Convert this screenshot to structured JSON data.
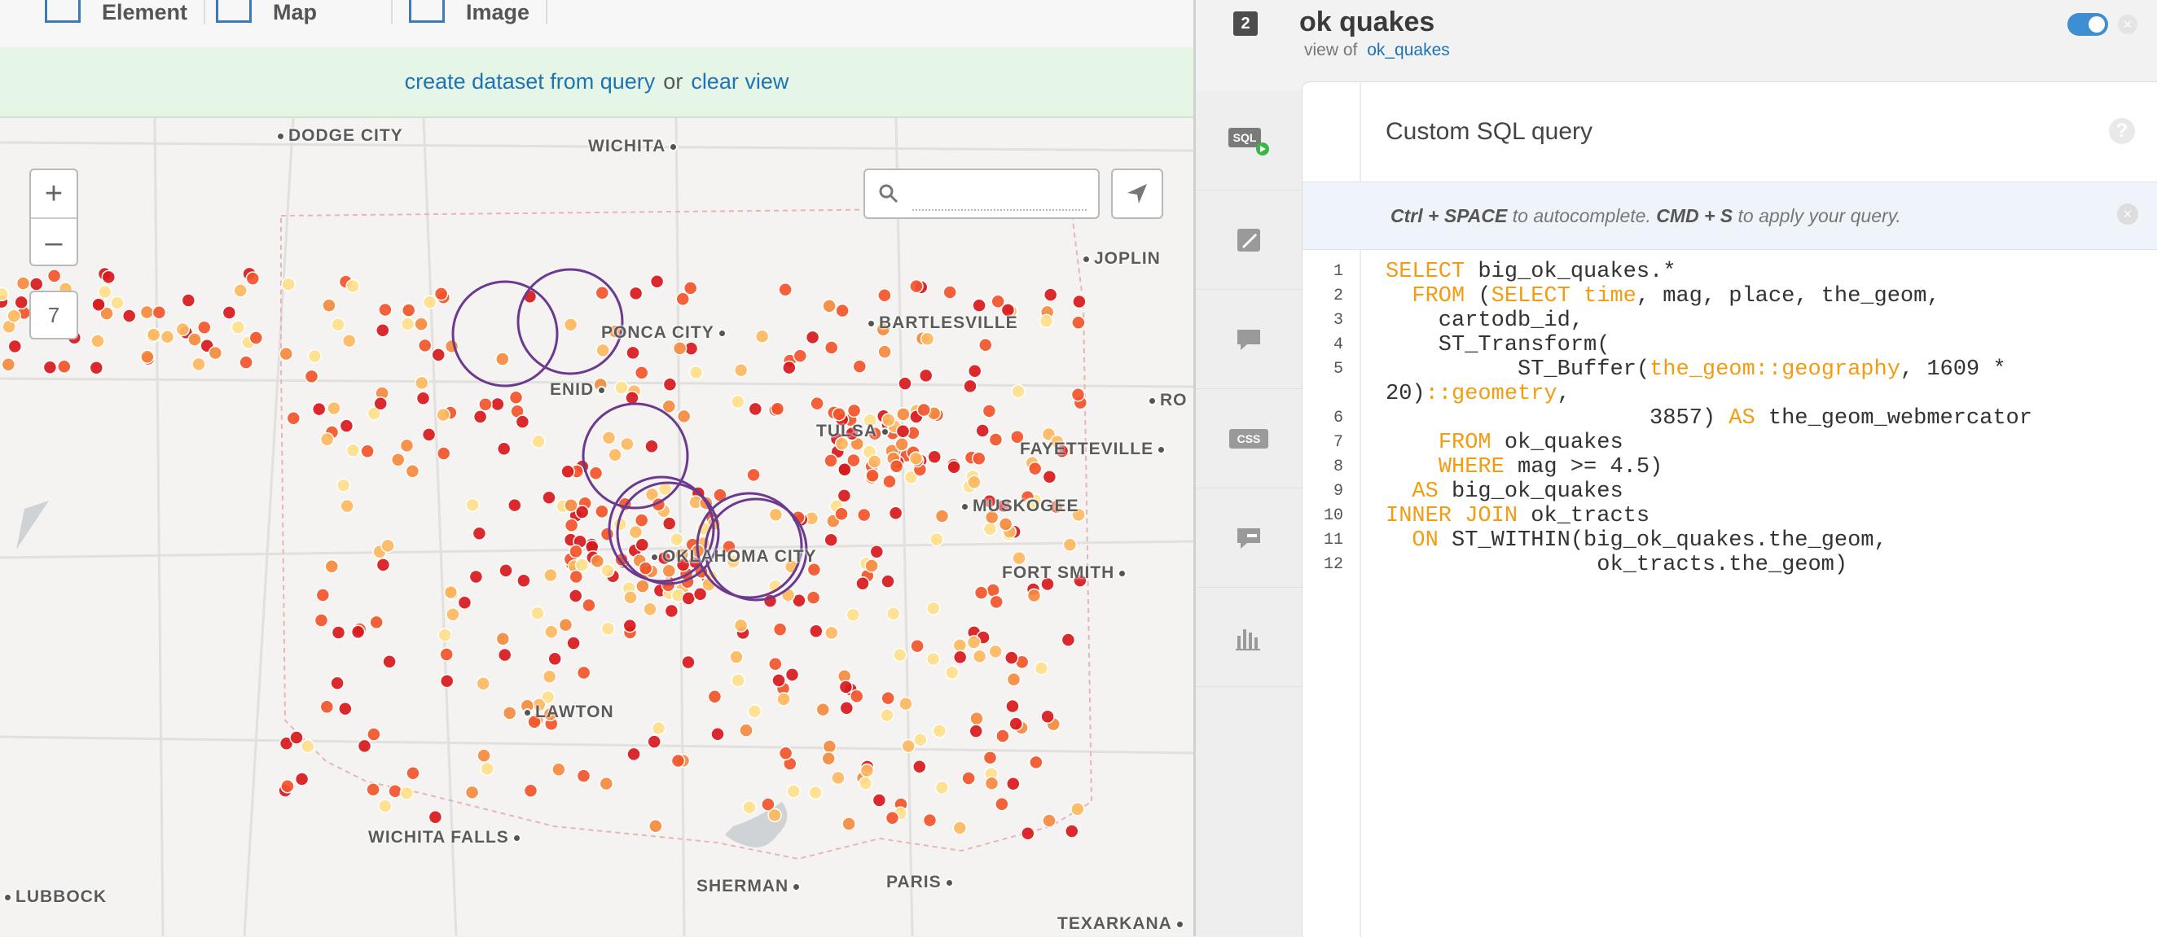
{
  "toolbar": {
    "items": [
      {
        "label": "Element",
        "icon": "element-icon"
      },
      {
        "label": "Map",
        "icon": "map-icon"
      },
      {
        "label": "Image",
        "icon": "image-icon"
      }
    ]
  },
  "banner": {
    "create_link": "create dataset from query",
    "or_text": "or",
    "clear_link": "clear view"
  },
  "map": {
    "zoom_in": "+",
    "zoom_out": "–",
    "zoom_level": "7",
    "search_placeholder": "",
    "cities": [
      "DODGE CITY",
      "WICHITA",
      "JOPLIN",
      "PONCA CITY",
      "BARTLESVILLE",
      "ENID",
      "RO",
      "TULSA",
      "FAYETTEVILLE",
      "MUSKOGEE",
      "OKLAHOMA CITY",
      "FORT SMITH",
      "LAWTON",
      "WICHITA FALLS",
      "SHERMAN",
      "PARIS",
      "LUBBOCK",
      "TEXARKANA"
    ],
    "marker_colors": {
      "dark": "#d7191c",
      "mid": "#f2552a",
      "orange": "#f48a3d",
      "light": "#fdb85e",
      "pale": "#fee08b"
    },
    "buffer_color": "#6b3a8f"
  },
  "layer": {
    "number": "2",
    "title": "ok quakes",
    "view_of_label": "view of",
    "view_of_link": "ok_quakes",
    "accent": "#3d8fd1"
  },
  "side_tabs": [
    {
      "name": "sql-tab",
      "icon": "sql-icon",
      "label": "SQL"
    },
    {
      "name": "wizard-tab",
      "icon": "brush-icon"
    },
    {
      "name": "infowindow-tab",
      "icon": "speech-bubble-icon"
    },
    {
      "name": "css-tab",
      "icon": "css-icon",
      "label": "CSS"
    },
    {
      "name": "legend-tab",
      "icon": "legend-icon"
    },
    {
      "name": "filters-tab",
      "icon": "bar-chart-icon"
    }
  ],
  "editor": {
    "title": "Custom SQL query",
    "help": "?",
    "hint_part1": "Ctrl + SPACE",
    "hint_part2": " to autocomplete. ",
    "hint_part3": "CMD + S",
    "hint_part4": " to apply your query.",
    "code_lines": [
      {
        "n": "1",
        "html": "<span class='kw'>SELECT</span> big_ok_quakes.*"
      },
      {
        "n": "2",
        "html": "  <span class='kw'>FROM</span> (<span class='kw'>SELECT</span> <span class='kw'>time</span>, mag, place, the_geom,"
      },
      {
        "n": "3",
        "html": "    cartodb_id,"
      },
      {
        "n": "4",
        "html": "    ST_Transform("
      },
      {
        "n": "5",
        "html": "          ST_Buffer(<span class='kw'>the_geom::geography</span>, 1609 *"
      },
      {
        "n": "",
        "html": "20)<span class='kw'>::geometry</span>,"
      },
      {
        "n": "6",
        "html": "                    3857) <span class='kw'>AS</span> the_geom_webmercator"
      },
      {
        "n": "7",
        "html": "    <span class='kw'>FROM</span> ok_quakes"
      },
      {
        "n": "8",
        "html": "    <span class='kw'>WHERE</span> mag >= 4.5)"
      },
      {
        "n": "9",
        "html": "  <span class='kw'>AS</span> big_ok_quakes"
      },
      {
        "n": "10",
        "html": "<span class='kw'>INNER JOIN</span> ok_tracts"
      },
      {
        "n": "11",
        "html": "  <span class='kw'>ON</span> ST_WITHIN(big_ok_quakes.the_geom,"
      },
      {
        "n": "12",
        "html": "                ok_tracts.the_geom)"
      }
    ]
  }
}
